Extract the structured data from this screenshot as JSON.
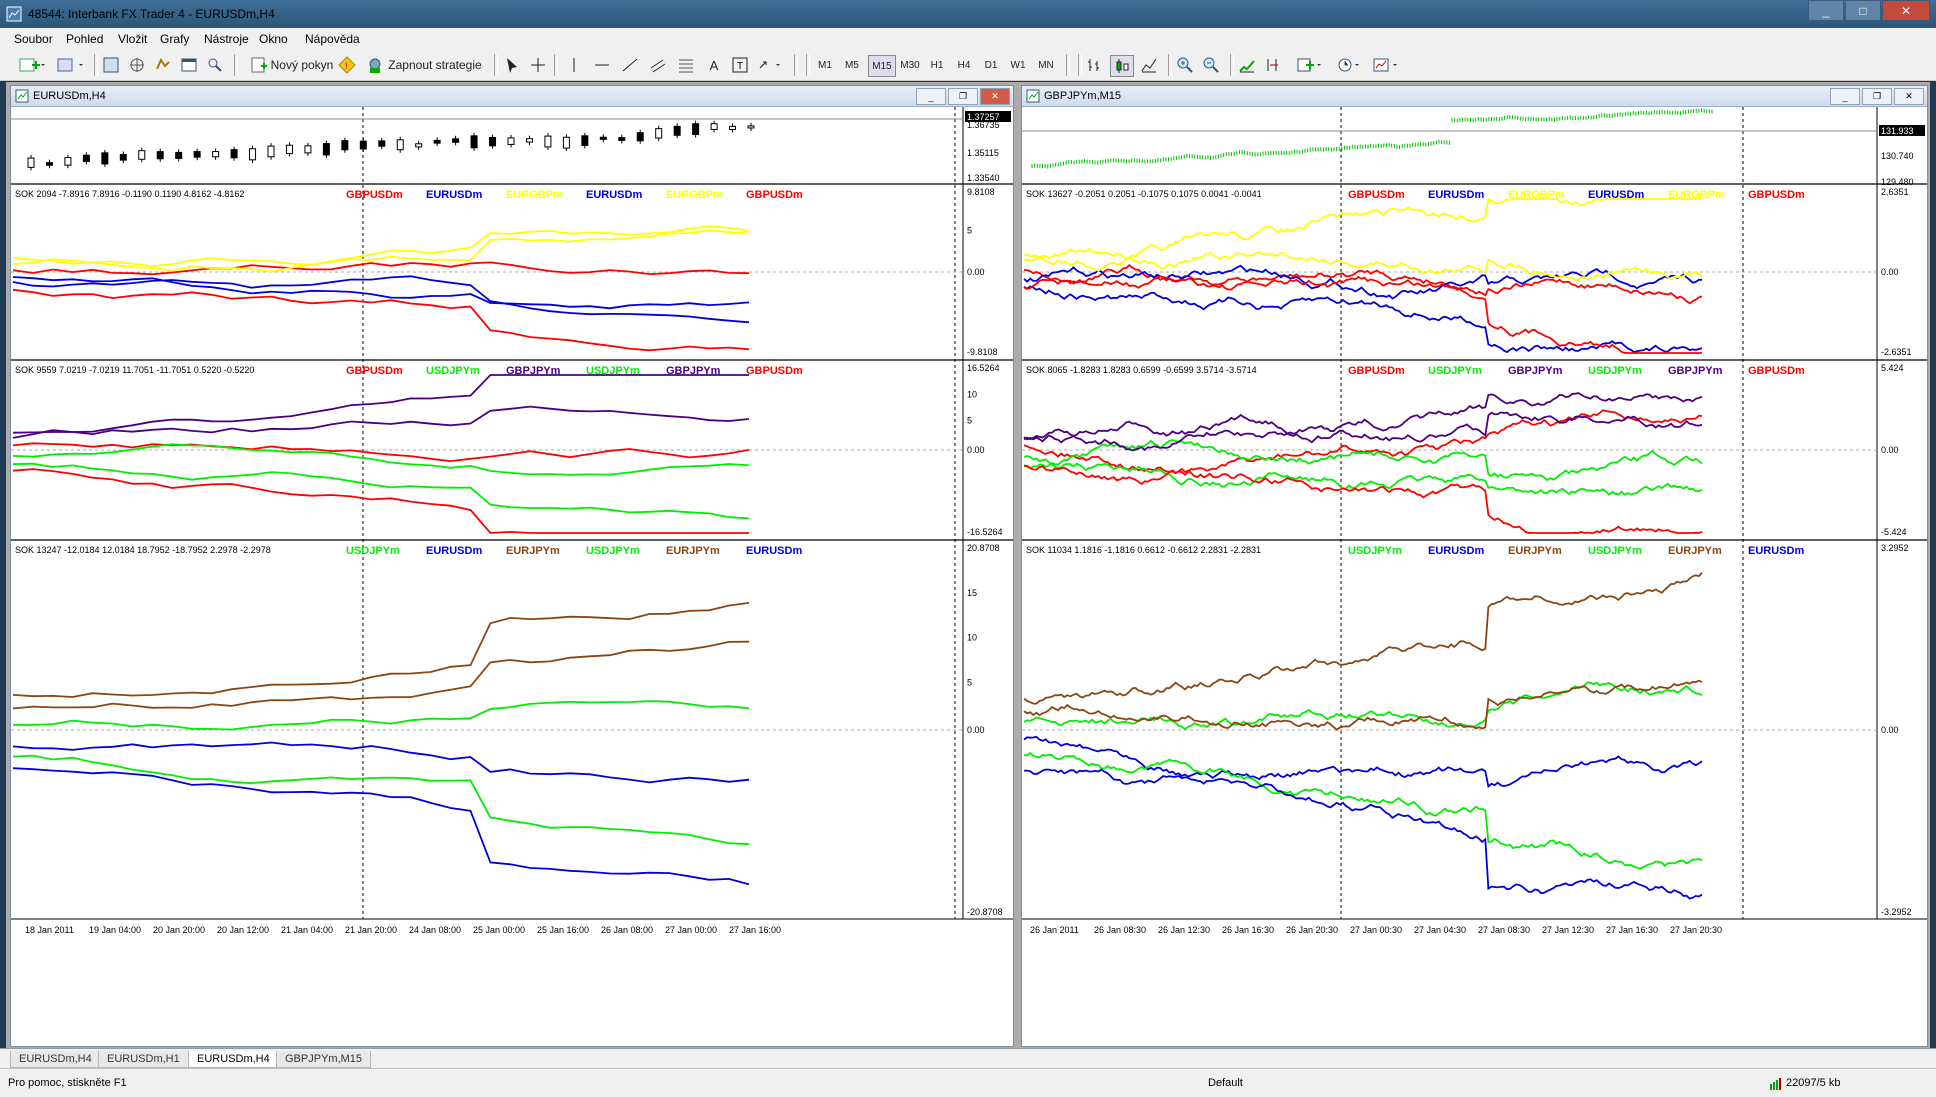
{
  "window": {
    "title": "48544: Interbank FX Trader 4 - EURUSDm,H4"
  },
  "menu": [
    "Soubor",
    "Pohled",
    "Vložit",
    "Grafy",
    "Nástroje",
    "Okno",
    "Nápověda"
  ],
  "toolbar": {
    "new_order": "Nový pokyn",
    "strategy": "Zapnout strategie",
    "periods": [
      "M1",
      "M5",
      "M15",
      "M30",
      "H1",
      "H4",
      "D1",
      "W1",
      "MN"
    ]
  },
  "left_chart": {
    "title": "EURUSDm,H4",
    "price_labels": [
      "1.37257",
      "1.36735",
      "1.35115",
      "1.33540"
    ],
    "panels": [
      {
        "info": "SOK 2094 -7.8916 7.8916 -0.1190 0.1190 4.8162 -4.8162",
        "legend": [
          {
            "text": "GBPUSDm",
            "color": "#ff0000"
          },
          {
            "text": "EURUSDm",
            "color": "#0000dd"
          },
          {
            "text": "EURGBPm",
            "color": "#ffff00"
          },
          {
            "text": "EURUSDm",
            "color": "#0000dd"
          },
          {
            "text": "EURGBPm",
            "color": "#ffff00"
          },
          {
            "text": "GBPUSDm",
            "color": "#ff0000"
          }
        ],
        "scale": [
          "9.8108",
          "5",
          "0.00",
          "-9.8108"
        ]
      },
      {
        "info": "SOK 9559 7.0219 -7.0219 11.7051 -11.7051 0.5220 -0.5220",
        "legend": [
          {
            "text": "GBPUSDm",
            "color": "#ff0000"
          },
          {
            "text": "USDJPYm",
            "color": "#00ee00"
          },
          {
            "text": "GBPJPYm",
            "color": "#4b0082"
          },
          {
            "text": "USDJPYm",
            "color": "#00ee00"
          },
          {
            "text": "GBPJPYm",
            "color": "#4b0082"
          },
          {
            "text": "GBPUSDm",
            "color": "#ff0000"
          }
        ],
        "scale": [
          "16.5264",
          "10",
          "5",
          "0.00",
          "-16.5264"
        ]
      },
      {
        "info": "SOK 13247 -12.0184 12.0184 18.7952 -18.7952 2.2978 -2.2978",
        "legend": [
          {
            "text": "USDJPYm",
            "color": "#00ee00"
          },
          {
            "text": "EURUSDm",
            "color": "#0000dd"
          },
          {
            "text": "EURJPYm",
            "color": "#8b4513"
          },
          {
            "text": "USDJPYm",
            "color": "#00ee00"
          },
          {
            "text": "EURJPYm",
            "color": "#8b4513"
          },
          {
            "text": "EURUSDm",
            "color": "#0000dd"
          }
        ],
        "scale": [
          "20.8708",
          "15",
          "10",
          "5",
          "0.00",
          "-20.8708"
        ]
      }
    ],
    "time_labels": [
      "18 Jan 2011",
      "19 Jan 04:00",
      "20 Jan 20:00",
      "20 Jan 12:00",
      "21 Jan 04:00",
      "21 Jan 20:00",
      "24 Jan 08:00",
      "25 Jan 00:00",
      "25 Jan 16:00",
      "26 Jan 08:00",
      "27 Jan 00:00",
      "27 Jan 16:00"
    ]
  },
  "right_chart": {
    "title": "GBPJPYm,M15",
    "price_labels": [
      "131.933",
      "130.740",
      "129.480"
    ],
    "panels": [
      {
        "info": "SOK 13627 -0.2051 0.2051 -0.1075 0.1075 0.0041 -0.0041",
        "legend": [
          {
            "text": "GBPUSDm",
            "color": "#ff0000"
          },
          {
            "text": "EURUSDm",
            "color": "#0000dd"
          },
          {
            "text": "EURGBPm",
            "color": "#ffff00"
          },
          {
            "text": "EURUSDm",
            "color": "#0000dd"
          },
          {
            "text": "EURGBPm",
            "color": "#ffff00"
          },
          {
            "text": "GBPUSDm",
            "color": "#ff0000"
          }
        ],
        "scale": [
          "2.6351",
          "0.00",
          "-2.6351"
        ]
      },
      {
        "info": "SOK 8065 -1.8283 1.8283 0.6599 -0.6599 3.5714 -3.5714",
        "legend": [
          {
            "text": "GBPUSDm",
            "color": "#ff0000"
          },
          {
            "text": "USDJPYm",
            "color": "#00ee00"
          },
          {
            "text": "GBPJPYm",
            "color": "#4b0082"
          },
          {
            "text": "USDJPYm",
            "color": "#00ee00"
          },
          {
            "text": "GBPJPYm",
            "color": "#4b0082"
          },
          {
            "text": "GBPUSDm",
            "color": "#ff0000"
          }
        ],
        "scale": [
          "5.424",
          "0.00",
          "-5.424"
        ]
      },
      {
        "info": "SOK 11034 1.1816 -1.1816 0.6612 -0.6612 2.2831 -2.2831",
        "legend": [
          {
            "text": "USDJPYm",
            "color": "#00ee00"
          },
          {
            "text": "EURUSDm",
            "color": "#0000dd"
          },
          {
            "text": "EURJPYm",
            "color": "#8b4513"
          },
          {
            "text": "USDJPYm",
            "color": "#00ee00"
          },
          {
            "text": "EURJPYm",
            "color": "#8b4513"
          },
          {
            "text": "EURUSDm",
            "color": "#0000dd"
          }
        ],
        "scale": [
          "3.2952",
          "0.00",
          "-3.2952"
        ]
      }
    ],
    "time_labels": [
      "26 Jan 2011",
      "26 Jan 08:30",
      "26 Jan 12:30",
      "26 Jan 16:30",
      "26 Jan 20:30",
      "27 Jan 00:30",
      "27 Jan 04:30",
      "27 Jan 08:30",
      "27 Jan 12:30",
      "27 Jan 16:30",
      "27 Jan 20:30"
    ]
  },
  "tabs": [
    "EURUSDm,H4",
    "EURUSDm,H1",
    "EURUSDm,H4",
    "GBPJPYm,M15"
  ],
  "active_tab_index": 2,
  "status": {
    "help": "Pro pomoc, stiskněte F1",
    "profile": "Default",
    "traffic": "22097/5 kb"
  }
}
